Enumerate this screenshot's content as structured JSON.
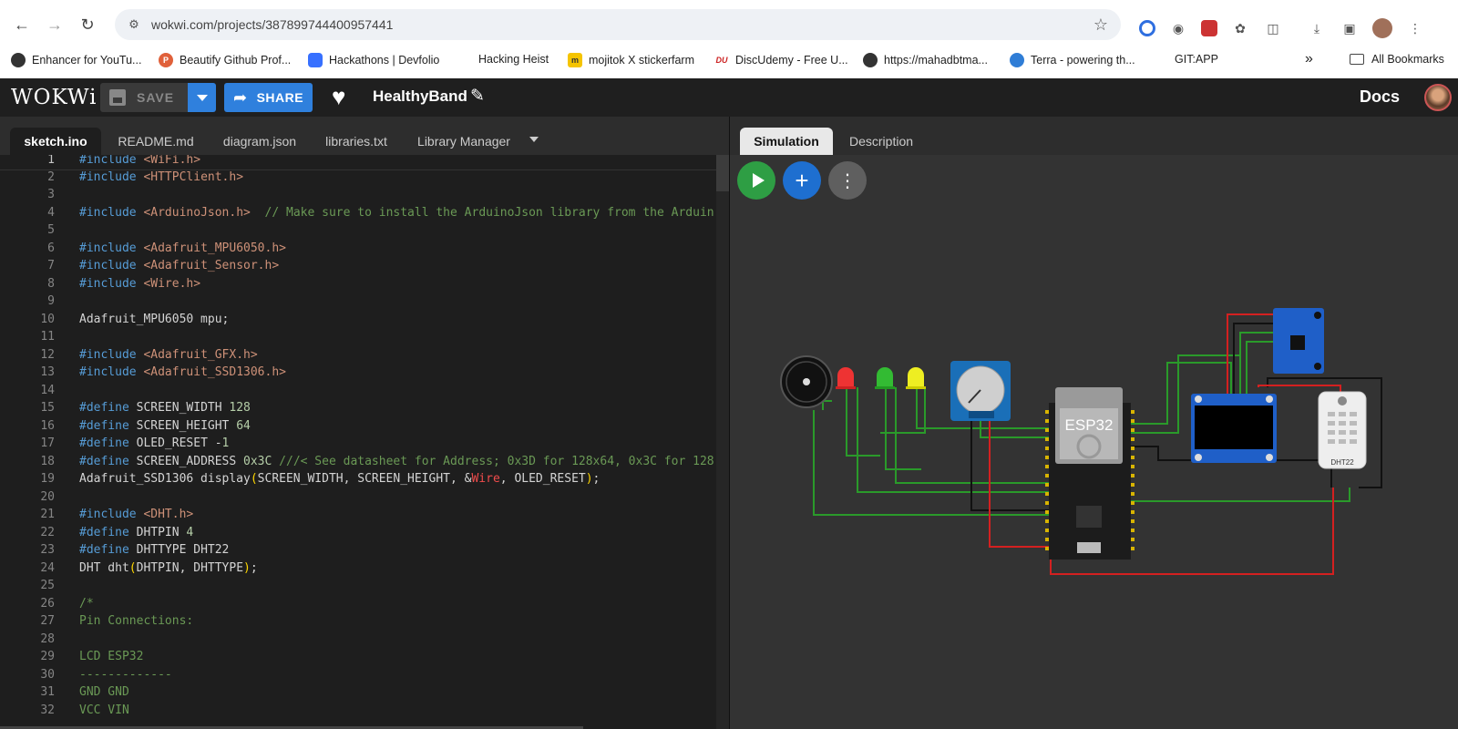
{
  "browser": {
    "url": "wokwi.com/projects/387899744400957441",
    "bookmarks": [
      {
        "label": "Enhancer for YouTu...",
        "icon": "enhancer-icon",
        "color": "#333333"
      },
      {
        "label": "Beautify Github Prof...",
        "icon": "beautify-icon",
        "color": "#e0603a"
      },
      {
        "label": "Hackathons | Devfolio",
        "icon": "devfolio-icon",
        "color": "#3770ff"
      },
      {
        "label": "Hacking Heist",
        "icon": "",
        "color": ""
      },
      {
        "label": "mojitok X stickerfarm",
        "icon": "mojitok-icon",
        "color": "#f5c400"
      },
      {
        "label": "DiscUdemy - Free U...",
        "icon": "discudemy-icon",
        "color": "#cc2222"
      },
      {
        "label": "https://mahadbtma...",
        "icon": "globe-icon",
        "color": "#333333"
      },
      {
        "label": "Terra - powering th...",
        "icon": "terra-icon",
        "color": "#2f7dd6"
      },
      {
        "label": "GIT:APP",
        "icon": "",
        "color": ""
      }
    ],
    "all_bookmarks": "All Bookmarks",
    "more": "»"
  },
  "header": {
    "logo": "WOKWi",
    "save_label": "SAVE",
    "share_label": "SHARE",
    "project_title": "HealthyBand",
    "docs_label": "Docs"
  },
  "editor": {
    "tabs": [
      "sketch.ino",
      "README.md",
      "diagram.json",
      "libraries.txt",
      "Library Manager"
    ],
    "active_tab": "sketch.ino",
    "lines": [
      {
        "n": "1",
        "html": "<span class=\"k\">#include</span> <span class=\"s\">&lt;WiFi.h&gt;</span>"
      },
      {
        "n": "2",
        "html": "<span class=\"k\">#include</span> <span class=\"s\">&lt;HTTPClient.h&gt;</span>"
      },
      {
        "n": "3",
        "html": ""
      },
      {
        "n": "4",
        "html": "<span class=\"k\">#include</span> <span class=\"s\">&lt;ArduinoJson.h&gt;</span>  <span class=\"c\">// Make sure to install the ArduinoJson library from the Arduin</span>"
      },
      {
        "n": "5",
        "html": ""
      },
      {
        "n": "6",
        "html": "<span class=\"k\">#include</span> <span class=\"s\">&lt;Adafruit_MPU6050.h&gt;</span>"
      },
      {
        "n": "7",
        "html": "<span class=\"k\">#include</span> <span class=\"s\">&lt;Adafruit_Sensor.h&gt;</span>"
      },
      {
        "n": "8",
        "html": "<span class=\"k\">#include</span> <span class=\"s\">&lt;Wire.h&gt;</span>"
      },
      {
        "n": "9",
        "html": ""
      },
      {
        "n": "10",
        "html": "Adafruit_MPU6050 mpu;"
      },
      {
        "n": "11",
        "html": ""
      },
      {
        "n": "12",
        "html": "<span class=\"k\">#include</span> <span class=\"s\">&lt;Adafruit_GFX.h&gt;</span>"
      },
      {
        "n": "13",
        "html": "<span class=\"k\">#include</span> <span class=\"s\">&lt;Adafruit_SSD1306.h&gt;</span>"
      },
      {
        "n": "14",
        "html": ""
      },
      {
        "n": "15",
        "html": "<span class=\"k\">#define</span> SCREEN_WIDTH <span class=\"n\">128</span>"
      },
      {
        "n": "16",
        "html": "<span class=\"k\">#define</span> SCREEN_HEIGHT <span class=\"n\">64</span>"
      },
      {
        "n": "17",
        "html": "<span class=\"k\">#define</span> OLED_RESET -<span class=\"n\">1</span>"
      },
      {
        "n": "18",
        "html": "<span class=\"k\">#define</span> SCREEN_ADDRESS <span class=\"n\">0x3C</span> <span class=\"c\">///&lt; See datasheet for Address; 0x3D for 128x64, 0x3C for 128</span>"
      },
      {
        "n": "19",
        "html": "Adafruit_SSD1306 display<span class=\"y\">(</span>SCREEN_WIDTH, SCREEN_HEIGHT, &amp;<span class=\"r\">Wire</span>, OLED_RESET<span class=\"y\">)</span>;"
      },
      {
        "n": "20",
        "html": ""
      },
      {
        "n": "21",
        "html": "<span class=\"k\">#include</span> <span class=\"s\">&lt;DHT.h&gt;</span>"
      },
      {
        "n": "22",
        "html": "<span class=\"k\">#define</span> DHTPIN <span class=\"n\">4</span>"
      },
      {
        "n": "23",
        "html": "<span class=\"k\">#define</span> DHTTYPE DHT22"
      },
      {
        "n": "24",
        "html": "DHT dht<span class=\"y\">(</span>DHTPIN, DHTTYPE<span class=\"y\">)</span>;"
      },
      {
        "n": "25",
        "html": ""
      },
      {
        "n": "26",
        "html": "<span class=\"c\">/*</span>"
      },
      {
        "n": "27",
        "html": "<span class=\"c\">Pin Connections:</span>"
      },
      {
        "n": "28",
        "html": ""
      },
      {
        "n": "29",
        "html": "<span class=\"c\">LCD ESP32</span>"
      },
      {
        "n": "30",
        "html": "<span class=\"c\">-------------</span>"
      },
      {
        "n": "31",
        "html": "<span class=\"c\">GND GND</span>"
      },
      {
        "n": "32",
        "html": "<span class=\"c\">VCC VIN</span>"
      }
    ]
  },
  "simulation": {
    "tabs": [
      "Simulation",
      "Description"
    ],
    "active_tab": "Simulation",
    "esp32_label": "ESP32",
    "dht_label": "DHT22"
  },
  "colors": {
    "accent": "#2f80dd",
    "play": "#2e9e44",
    "add": "#1e6fd0",
    "menu": "#5f5f5f",
    "wire_green": "#2a9a2a",
    "wire_red": "#d42020",
    "wire_black": "#111111"
  }
}
